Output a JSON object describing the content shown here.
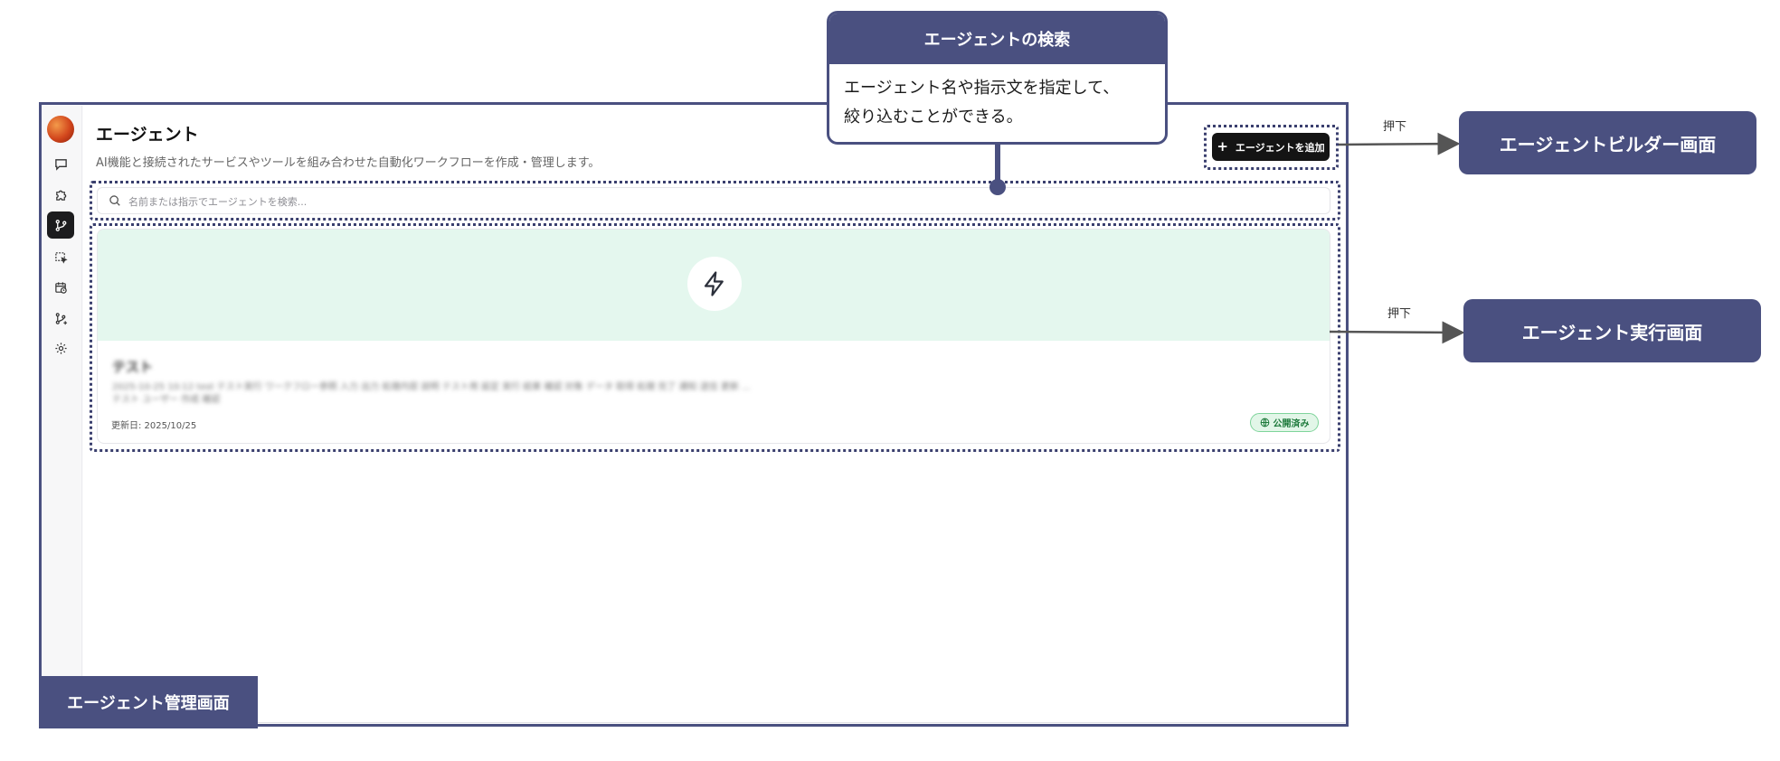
{
  "diagram": {
    "callout": {
      "title": "エージェントの検索",
      "body": "エージェント名や指示文を指定して、\n絞り込むことができる。"
    },
    "targets": {
      "builder": "エージェントビルダー画面",
      "runner": "エージェント実行画面"
    },
    "arrow_label_builder": "押下",
    "arrow_label_runner": "押下",
    "frame_label": "エージェント管理画面",
    "accent_color": "#4a5080"
  },
  "app": {
    "sidebar_icons": [
      "chat-icon",
      "puzzle-icon",
      "workflow-icon",
      "select-icon",
      "calendar-clock-icon",
      "git-branch-plus-icon",
      "settings-icon"
    ],
    "page_title": "エージェント",
    "page_description": "AI機能と接続されたサービスやツールを組み合わせた自動化ワークフローを作成・管理します。",
    "add_button_label": "エージェントを追加",
    "search_placeholder": "名前または指示でエージェントを検索...",
    "card": {
      "name": "テスト",
      "blurred_text_1": "2025-10-25 10:12 test テスト実行 ワークフロー参照 入力 出力 処理内容 説明 テスト用 設定 実行 結果 確認 対象 データ 取得 処理 完了 通知 送信 更新 ...",
      "blurred_text_2": "テスト ユーザー 作成 確認",
      "updated_label": "更新日: 2025/10/25",
      "status_badge": "公開済み",
      "banner_color": "#e4f7ee"
    }
  }
}
